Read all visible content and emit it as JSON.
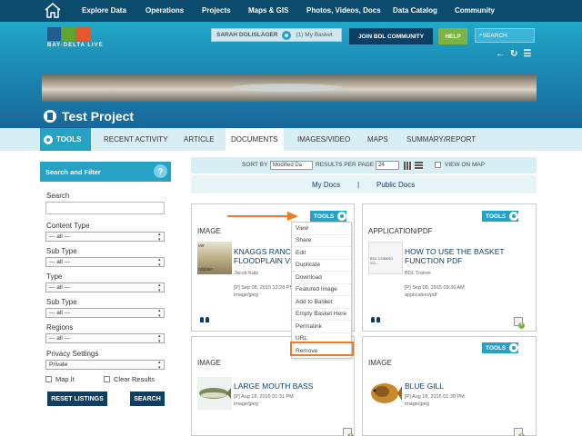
{
  "nav": {
    "items": [
      "Explore Data",
      "Operations",
      "Projects",
      "Maps & GIS",
      "Photos, Videos, Docs",
      "Data Catalog",
      "Community"
    ]
  },
  "brand": {
    "logo_text": "BAY-DELTA LIVE"
  },
  "header": {
    "user": "SARAH DOLISLAGER",
    "basket": "(1) My Basket",
    "community_btn": "JOIN BDL COMMUNITY",
    "help_btn": "HELP",
    "search_placeholder": "SEARCH"
  },
  "project": {
    "title": "Test Project"
  },
  "tabs": {
    "tools": "TOOLS",
    "recent": "RECENT ACTIVITY",
    "article": "ARTICLE",
    "documents": "DOCUMENTS",
    "images": "IMAGES/VIDEO",
    "maps": "MAPS",
    "summary": "SUMMARY/REPORT"
  },
  "filter": {
    "header": "Search and Filter",
    "search_label": "Search",
    "content_type_label": "Content Type",
    "content_type_value": "--- all ---",
    "sub_type_label": "Sub Type",
    "sub_type_value": "--- all ---",
    "type_label": "Type",
    "type_value": "--- all ---",
    "sub_type2_label": "Sub Type",
    "sub_type2_value": "--- all ---",
    "regions_label": "Regions",
    "regions_value": "--- all ---",
    "privacy_label": "Privacy Settings",
    "privacy_value": "Private",
    "map_it": "Map It",
    "clear_results": "Clear Results",
    "reset_btn": "RESET LISTINGS",
    "search_btn": "SEARCH"
  },
  "sortbar": {
    "sort_by": "SORT BY",
    "sort_value": "Modified Da",
    "per_page_label": "RESULTS PER PAGE",
    "per_page_value": "24",
    "view_on_map": "VIEW ON MAP"
  },
  "doctabs": {
    "my_docs": "My Docs",
    "separator": "|",
    "public_docs": "Public Docs"
  },
  "cards": [
    {
      "type": "IMAGE",
      "title": "KNAGGS RANCH FLOODPLAIN VS.",
      "author": "Jacob Katz",
      "date": "[P] Sep 08, 2015 12:28 PM",
      "mime": "image/jpeg",
      "tools": "TOOLS"
    },
    {
      "type": "APPLICATION/PDF",
      "title": "HOW TO USE THE BASKET FUNCTION PDF",
      "author": "BDL Trainer",
      "date": "[P] Sep 08, 2015 09:36 AM",
      "mime": "application/pdf",
      "tools": "TOOLS",
      "thumb_text": "BDL COMING SO..."
    },
    {
      "type": "IMAGE",
      "title": "LARGE MOUTH BASS",
      "date": "[P] Aug 18, 2015 01:31 PM",
      "mime": "image/jpeg"
    },
    {
      "type": "IMAGE",
      "title": "BLUE GILL",
      "date": "[P] Aug 18, 2015 01:30 PM",
      "mime": "image/jpeg",
      "tools": "TOOLS"
    }
  ],
  "menu": [
    "View",
    "Share",
    "Edit",
    "Duplicate",
    "Download",
    "Featured Image",
    "Add to Basket",
    "Empty Basket Here",
    "Permalink",
    "URL",
    "Remove"
  ],
  "colors": {
    "nav": "#0b4b6e",
    "accent": "#26a3c4",
    "dark": "#0d3f63",
    "highlight": "#ef7b22",
    "green": "#7cb342"
  }
}
